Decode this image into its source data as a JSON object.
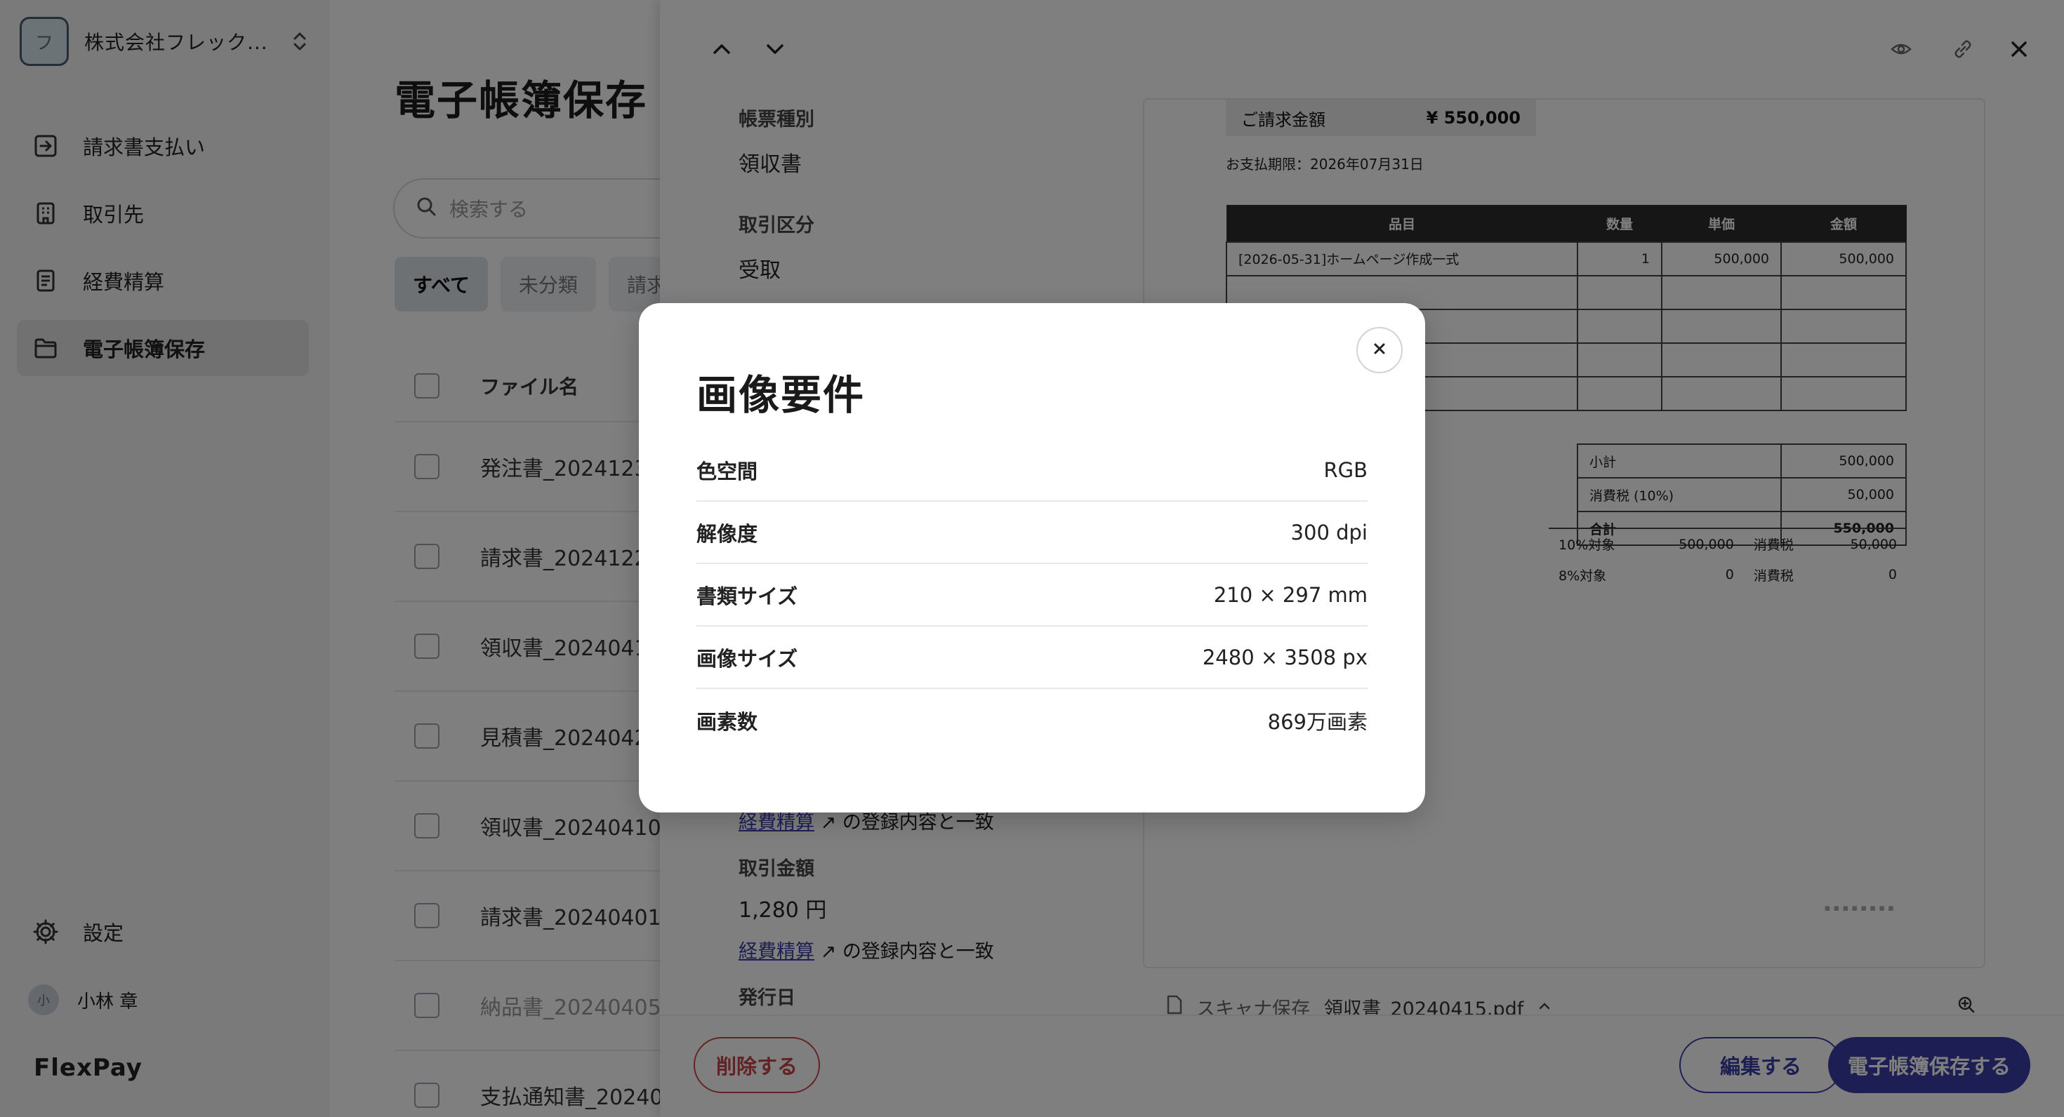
{
  "sidebar": {
    "company_initial": "フ",
    "company_name": "株式会社フレック...",
    "items": [
      {
        "label": "請求書支払い"
      },
      {
        "label": "取引先"
      },
      {
        "label": "経費精算"
      },
      {
        "label": "電子帳簿保存"
      }
    ],
    "settings_label": "設定",
    "user_initial": "小",
    "user_name": "小林 章",
    "brand": "FlexPay"
  },
  "main": {
    "title": "電子帳簿保存",
    "search_placeholder": "検索する",
    "filters": [
      "すべて",
      "未分類",
      "請求"
    ],
    "column_filename": "ファイル名",
    "rows": [
      "発注書_2024123",
      "請求書_2024122",
      "領収書_2024041",
      "見積書_2024042",
      "領収書_20240410.p",
      "請求書_20240401.p",
      "納品書_20240405.",
      "支払通知書_20240"
    ]
  },
  "detail": {
    "doc_type_label": "帳票種別",
    "doc_type_value": "領収書",
    "txn_type_label": "取引区分",
    "txn_type_value": "受取",
    "link_label": "経費精算",
    "match_text": "の登録内容と一致",
    "amount_label": "取引金額",
    "amount_value": "1,280 円",
    "issue_date_label": "発行日",
    "scan_label": "スキャナ保存",
    "file_name": "領収書_20240415.pdf",
    "delete_label": "削除する",
    "edit_label": "編集する",
    "save_label": "電子帳簿保存する"
  },
  "document": {
    "total_label": "ご請求金額",
    "total_value": "¥ 550,000",
    "due_text": "お支払期限：2026年07月31日",
    "headers": [
      "品目",
      "数量",
      "単価",
      "金額"
    ],
    "item": {
      "name": "[2026-05-31]ホームページ作成一式",
      "qty": "1",
      "unit_price": "500,000",
      "amount": "500,000"
    },
    "subtotal_label": "小計",
    "subtotal_value": "500,000",
    "tax_label": "消費税 (10%)",
    "tax_value": "50,000",
    "grand_label": "合計",
    "grand_value": "550,000",
    "tax_rows": [
      {
        "rate": "10%対象",
        "base": "500,000",
        "tax_label": "消費税",
        "tax": "50,000"
      },
      {
        "rate": "8%対象",
        "base": "0",
        "tax_label": "消費税",
        "tax": "0"
      }
    ]
  },
  "modal": {
    "title": "画像要件",
    "rows": [
      {
        "label": "色空間",
        "value": "RGB"
      },
      {
        "label": "解像度",
        "value": "300 dpi"
      },
      {
        "label": "書類サイズ",
        "value": "210 × 297 mm"
      },
      {
        "label": "画像サイズ",
        "value": "2480 × 3508 px"
      },
      {
        "label": "画素数",
        "value": "869万画素"
      }
    ]
  },
  "colors": {
    "accent": "#3a3ea8",
    "danger": "#c6464b",
    "overlay": "rgba(0,0,0,0.5)"
  }
}
